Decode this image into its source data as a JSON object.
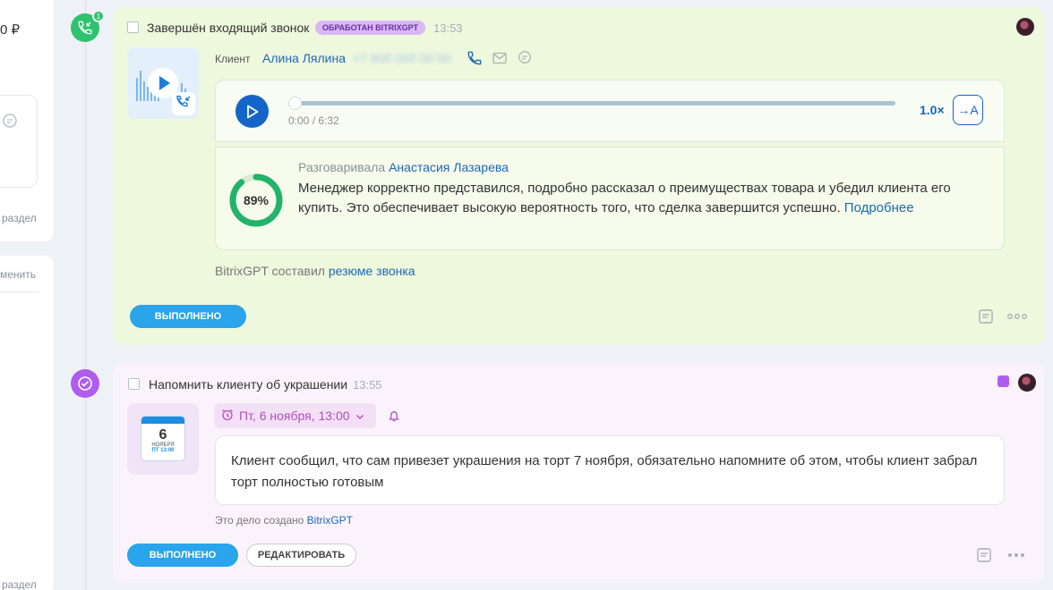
{
  "left_panel": {
    "price_fragment": "0 ₽",
    "section_label_1": "раздел",
    "change_label": "менить",
    "section_label_2": "раздел"
  },
  "call_activity": {
    "title": "Завершён входящий звонок",
    "gpt_tag": "ОБРАБОТАН BITRIXGPT",
    "time": "13:53",
    "badge_count": "1",
    "client_label": "Клиент",
    "client_name": "Алина Лялина",
    "client_phone": "+7 900 000 00 00",
    "player": {
      "time": "0:00 / 6:32",
      "progress": 0,
      "speed": "1.0×",
      "transcribe_label": "→A"
    },
    "summary": {
      "score": "89%",
      "score_value": 89,
      "talked_prefix": "Разговаривала",
      "manager": "Анастасия Лазарева",
      "text": "Менеджер корректно представился, подробно рассказал о преимуществах товара и убедил клиента его купить. Это обеспечивает высокую вероятность того, что сделка завершится успешно.",
      "more_link": "Подробнее"
    },
    "gpt_note_prefix": "BitrixGPT составил",
    "gpt_note_link": "резюме звонка",
    "done_button": "ВЫПОЛНЕНО"
  },
  "task_activity": {
    "title": "Напомнить клиенту об украшении",
    "time": "13:55",
    "calendar": {
      "day": "6",
      "month": "НОЯБРЯ",
      "weekday_time": "ПТ 13:00"
    },
    "deadline": "Пт, 6 ноября, 13:00",
    "description": "Клиент сообщил, что сам привезет украшения на торт 7 ноября, обязательно напомните об этом, чтобы клиент забрал торт полностью готовым",
    "created_prefix": "Это дело создано",
    "created_by": "BitrixGPT",
    "done_button": "ВЫПОЛНЕНО",
    "edit_button": "РЕДАКТИРОВАТЬ"
  },
  "colors": {
    "call_card_bg": "#eef8dd",
    "task_card_bg": "#fbf3fb",
    "accent_blue": "#1565c8",
    "done_button": "#2aa4ea",
    "call_icon": "#2fc26e",
    "task_icon": "#b05cf0"
  }
}
